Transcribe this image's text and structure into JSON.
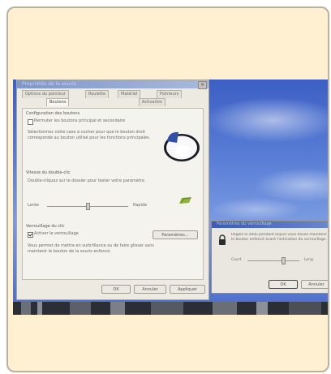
{
  "main_dialog": {
    "title": "Propriétés de la souris",
    "close_glyph": "×",
    "tabs_row1": [
      "Options du pointeur",
      "Roulette",
      "Matériel",
      "Pointeurs"
    ],
    "tabs_row2": [
      "Boutons",
      "Activation"
    ],
    "group1_label": "Configuration des boutons",
    "group1_checkbox": "Permuter les boutons principal et secondaire",
    "group1_text": "Sélectionnez cette case à cocher pour que le bouton droit corresponde au bouton utilisé pour les fonctions principales.",
    "group2_label": "Vitesse du double-clic",
    "group2_text": "Double-cliquez sur le dossier pour tester votre paramètre.",
    "speed_slow": "Lente",
    "speed_fast": "Rapide",
    "group3_label": "Verrouillage du clic",
    "group3_checkbox": "Activer le verrouillage",
    "group3_text": "Vous permet de mettre en surbrillance ou de faire glisser sans maintenir le bouton de la souris enfoncé.",
    "settings_button": "Paramètres...",
    "ok_button": "OK",
    "cancel_button": "Annuler",
    "apply_button": "Appliquer"
  },
  "secondary_dialog": {
    "title": "Paramètres du verrouillage",
    "text": "Réglez le délai pendant lequel vous devez maintenir le bouton enfoncé avant l'activation du verrouillage.",
    "short_label": "Court",
    "long_label": "Long",
    "ok_button": "OK",
    "cancel_button": "Annuler"
  },
  "colors": {
    "card_background": "#fff0d2",
    "card_border": "#b9b0a2",
    "dialog_face": "#eceae1",
    "titlebar": "#7e97c9",
    "desktop_sky": "#4a6ac8"
  },
  "icons": [
    "mouse-icon",
    "folder-icon",
    "lock-icon",
    "close-icon"
  ]
}
